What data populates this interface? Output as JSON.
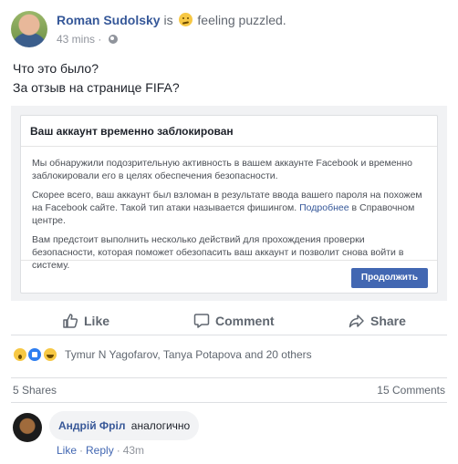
{
  "post": {
    "author": "Roman Sudolsky",
    "is_text": "is",
    "feeling": "feeling puzzled.",
    "time": "43 mins",
    "text_line1": "Что это было?",
    "text_line2": "За отзыв на странице FIFA?"
  },
  "dialog": {
    "title": "Ваш аккаунт временно заблокирован",
    "paragraph1": "Мы обнаружили подозрительную активность в вашем аккаунте Facebook и временно заблокировали его в целях обеспечения безопасности.",
    "paragraph2_before": "Скорее всего, ваш аккаунт был взломан в результате ввода вашего пароля на похожем на Facebook сайте. Такой тип атаки называется фишингом.",
    "paragraph2_link": "Подробнее",
    "paragraph2_after": "в Справочном центре.",
    "paragraph3": "Вам предстоит выполнить несколько действий для прохождения проверки безопасности, которая поможет обезопасить ваш аккаунт и позволит снова войти в систему.",
    "button": "Продолжить"
  },
  "actions": {
    "like": "Like",
    "comment": "Comment",
    "share": "Share"
  },
  "reactions": {
    "names": "Tymur N Yagofarov, Tanya Potapova and 20 others",
    "icons": [
      "wow-icon",
      "like-icon",
      "haha-icon"
    ]
  },
  "counts": {
    "shares": "5 Shares",
    "comments": "15 Comments"
  },
  "comment": {
    "author": "Андрій Фріл",
    "text": "аналогично",
    "like": "Like",
    "reply": "Reply",
    "time": "43m",
    "separator": "·"
  },
  "colors": {
    "link": "#365899",
    "button": "#4267b2",
    "muted": "#90949c"
  }
}
